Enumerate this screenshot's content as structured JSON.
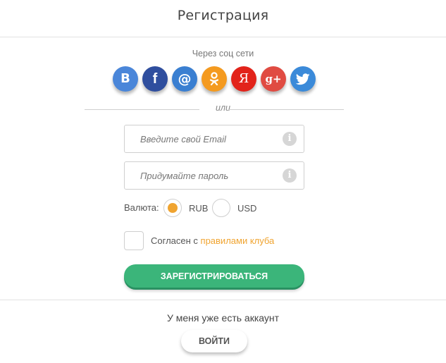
{
  "header": {
    "title": "Регистрация"
  },
  "social": {
    "label": "Через соц сети",
    "buttons": [
      {
        "name": "vk",
        "icon": "vk-icon",
        "glyph": "В",
        "color": "#4a86d9"
      },
      {
        "name": "facebook",
        "icon": "facebook-icon",
        "glyph": "f",
        "color": "#2f4e9e"
      },
      {
        "name": "mailru",
        "icon": "mailru-icon",
        "glyph": "@",
        "color": "#3a7fd1"
      },
      {
        "name": "odnoklassniki",
        "icon": "odnoklassniki-icon",
        "glyph": "",
        "color": "#f49a1f"
      },
      {
        "name": "yandex",
        "icon": "yandex-icon",
        "glyph": "Я",
        "color": "#e2231a"
      },
      {
        "name": "google-plus",
        "icon": "google-plus-icon",
        "glyph": "g+",
        "color": "#e04b42"
      },
      {
        "name": "twitter",
        "icon": "twitter-icon",
        "glyph": "",
        "color": "#3b8ad9"
      }
    ]
  },
  "divider": {
    "label": "или"
  },
  "form": {
    "email_placeholder": "Введите свой Email",
    "email_value": "",
    "password_placeholder": "Придумайте пароль",
    "password_value": "",
    "info_glyph": "i",
    "currency_label": "Валюта:",
    "currency_options": [
      "RUB",
      "USD"
    ],
    "currency_selected": "RUB",
    "agree_prefix": "Согласен с ",
    "agree_link": "правилами клуба",
    "agree_checked": false,
    "register_label": "ЗАРЕГИСТРИРОВАТЬСЯ"
  },
  "footer": {
    "have_account": "У меня уже есть аккаунт",
    "login_label": "ВОЙТИ"
  },
  "colors": {
    "accent": "#f0a430",
    "register_green": "#3bb57a"
  }
}
